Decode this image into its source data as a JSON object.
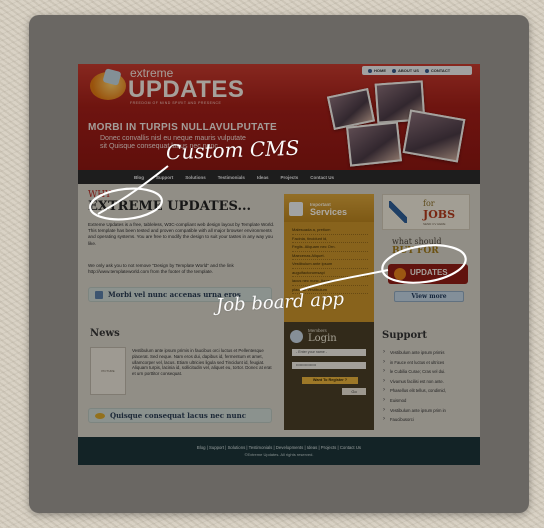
{
  "site": {
    "logo_small": "extreme",
    "logo_big": "UPDATES",
    "logo_tagline": "FREEDOM OF MIND SPIRIT AND PRESENCE",
    "top_nav": [
      "HOME",
      "ABOUT US",
      "CONTACT"
    ],
    "headline": "MORBI IN TURPIS NULLAVULPUTATE",
    "subline_1": "Donec convallis nisl eu neque mauris vulputate",
    "subline_2": "sit Quisque consequat lacus nec nunc",
    "nav": [
      "Blog",
      "Support",
      "Solutions",
      "Testimonials",
      "Ideas",
      "Projects",
      "Contact Us"
    ]
  },
  "main": {
    "why": "WHY",
    "title": "EXTREME UPDATES...",
    "body_1": "Extreme Updates is a free, tableless, W3C-compliant web design layout by Template World. This template has been tested and proven compatible with all major browser environments and operating systems. You are free to modify the design to suit your tastes in any way you like.",
    "body_2": "We only ask you to not remove \"Design by Template World\" and the link http://www.templateworld.com from the footer of the template.",
    "promo_1": "Morbi vel nunc accenas urna eros",
    "news_title": "News",
    "news_image_label": "PICTURE",
    "news_body": "Vestibulum ante ipsum primis in faucibus orci luctus et Pellentesque placerat. Sed neque. Nam eros dui, dapibus id, fermentum et amet, ullamcorper vel, lacus. Etiam ultricies ligula sed Tincidunt id, feugiat. Aliquam turpis, lacinia id, sollicitudin vel, aliquet eu, tortor. Donec at erat et urn porttitor consequat.",
    "promo_2": "Quisque consequat lacus nec nunc"
  },
  "services": {
    "heading_small": "Important",
    "heading_big": "Services",
    "items": [
      "Malesuada a, pretium",
      "Facinia, tincidunt id,",
      "Fegiis. Aliquam nec Orn.",
      "Maecenas Aliquet.",
      "Vestibulum ante ipsum",
      "auguifactorumsapi",
      "lacus nec nunc. Aenean",
      "placerat Vestibulum"
    ]
  },
  "login": {
    "heading_small": "Members",
    "heading_big": "Login",
    "username_placeholder": "- Enter your name -",
    "password_placeholder": "••••••••••••••••",
    "register": "Want To Register ?",
    "go": "Go"
  },
  "right": {
    "jobs_for": "for",
    "jobs_word": "JOBS",
    "jobs_sub": "SEND CV HERE",
    "what_should": "what should",
    "buy_for": "BUY FOR",
    "badge": "UPDATES",
    "view_more": "View more",
    "support_title": "Support",
    "support_items": [
      "Vestibulum ante ipsum primis",
      "in Fauce ent luctus et ultrices",
      "le Cubilia Curae; Cras vel dui.",
      "Vivamus facilisi est non ante.",
      "Phasellus elit tellus, condimid,",
      "Euismod",
      "Vestibulum ante ipsum prim in",
      "Faucibusorci"
    ]
  },
  "footer": {
    "links": "Blog   |   Support   |   Solutions   |   Testimonials   |   Developments   |   Ideas   |   Projects   |   Contact Us",
    "copy": "©Extreme Updates. All rights reserved."
  },
  "annotations": {
    "cms": "Custom CMS",
    "job": "Job board app"
  }
}
